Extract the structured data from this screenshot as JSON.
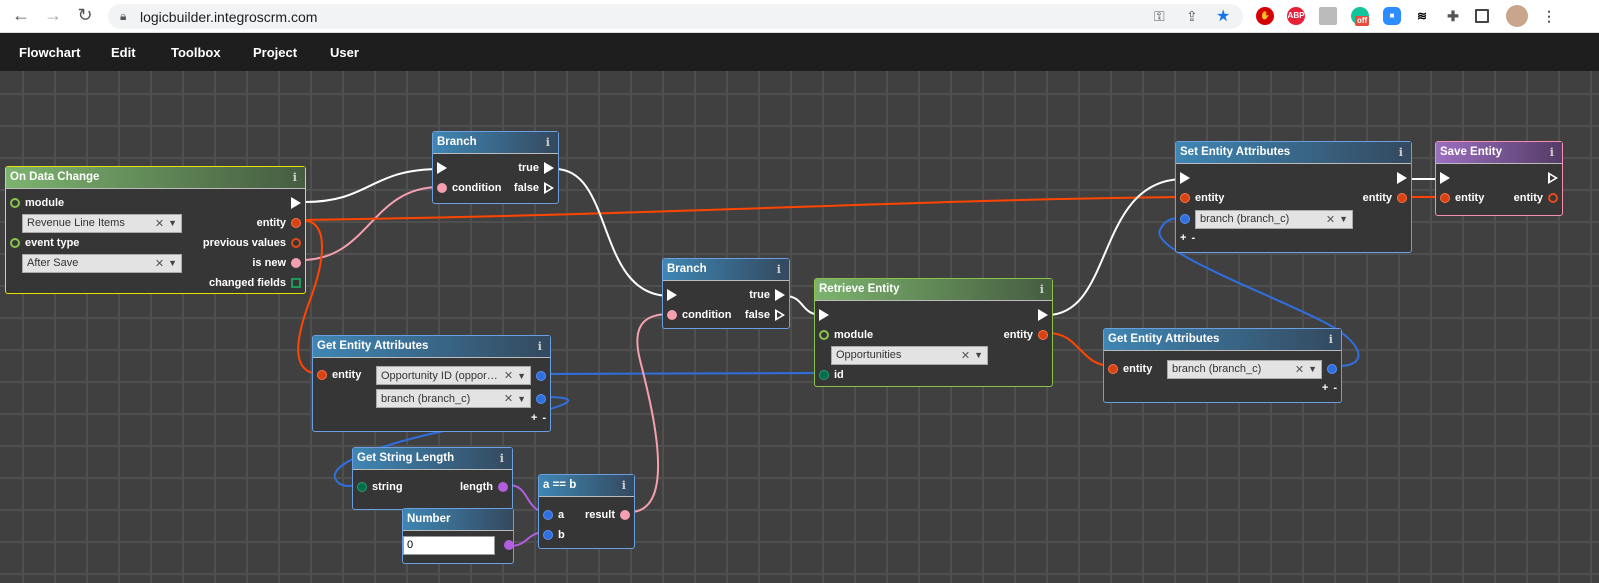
{
  "browser": {
    "url": "logicbuilder.integroscrm.com",
    "ext_off_badge": "off",
    "abp": "ABP"
  },
  "menu": [
    "Flowchart",
    "Edit",
    "Toolbox",
    "Project",
    "User"
  ],
  "colors": {
    "accent": "#3f86b4",
    "exec_wire": "#ffffff",
    "entity_wire": "#ff4500",
    "field_wire": "#2f6fe0",
    "bool_wire": "#f4a0b0",
    "number_wire": "#b25ee0"
  },
  "nodes": {
    "on_data_change": {
      "title": "On Data Change",
      "module_label": "module",
      "module_value": "Revenue Line Items",
      "event_label": "event type",
      "event_value": "After Save",
      "outputs": [
        "entity",
        "previous values",
        "is new",
        "changed fields"
      ]
    },
    "branch1": {
      "title": "Branch",
      "condition": "condition",
      "true": "true",
      "false": "false"
    },
    "branch2": {
      "title": "Branch",
      "condition": "condition",
      "true": "true",
      "false": "false"
    },
    "retrieve_entity": {
      "title": "Retrieve Entity",
      "module_label": "module",
      "module_value": "Opportunities",
      "id_label": "id",
      "entity_out": "entity"
    },
    "get_entity_attrs1": {
      "title": "Get Entity Attributes",
      "entity_label": "entity",
      "fields": [
        "Opportunity ID (opportunity_id)",
        "branch (branch_c)"
      ]
    },
    "get_string_length": {
      "title": "Get String Length",
      "string_label": "string",
      "length_label": "length"
    },
    "equals": {
      "title": "a == b",
      "a": "a",
      "b": "b",
      "result": "result"
    },
    "number": {
      "title": "Number",
      "value": "0"
    },
    "set_entity_attrs": {
      "title": "Set Entity Attributes",
      "entity_in": "entity",
      "entity_out": "entity",
      "fields": [
        "branch (branch_c)"
      ]
    },
    "save_entity": {
      "title": "Save Entity",
      "entity_in": "entity",
      "entity_out": "entity"
    },
    "get_entity_attrs2": {
      "title": "Get Entity Attributes",
      "entity_label": "entity",
      "fields": [
        "branch (branch_c)"
      ]
    }
  },
  "labels": {
    "plus": "+",
    "minus": "-",
    "info": "i",
    "clear": "✕",
    "dropdown": "▼"
  }
}
